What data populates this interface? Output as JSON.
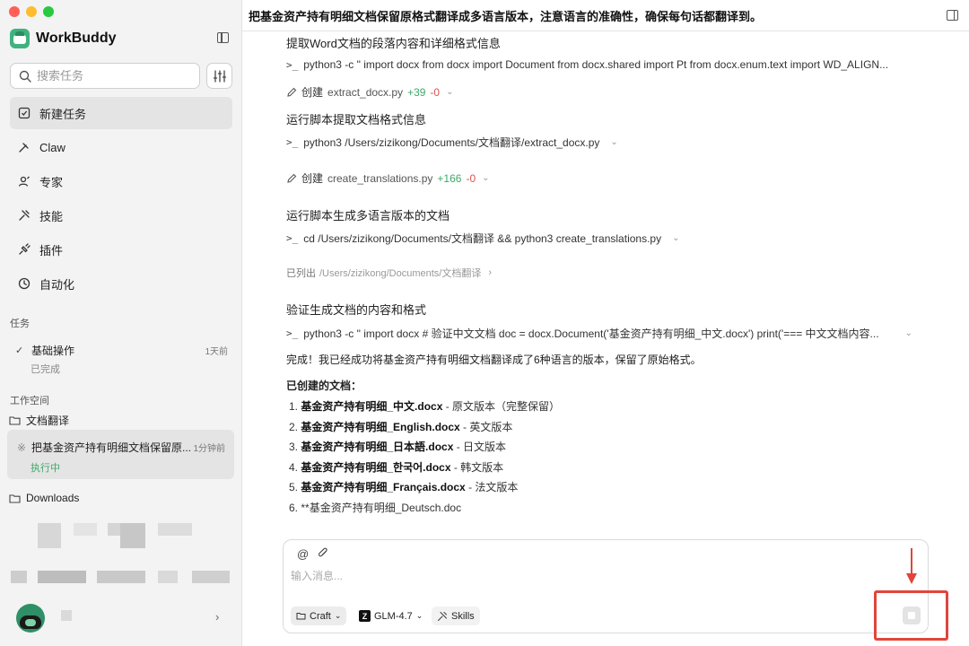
{
  "app": {
    "name": "WorkBuddy"
  },
  "sidebar": {
    "search_placeholder": "搜索任务",
    "nav": [
      {
        "label": "新建任务",
        "icon": "edit-square-icon",
        "active": true
      },
      {
        "label": "Claw",
        "icon": "claw-icon"
      },
      {
        "label": "专家",
        "icon": "experts-icon"
      },
      {
        "label": "技能",
        "icon": "skills-icon"
      },
      {
        "label": "插件",
        "icon": "plugin-icon"
      },
      {
        "label": "自动化",
        "icon": "clock-icon"
      }
    ],
    "tasks_label": "任务",
    "task": {
      "title": "基础操作",
      "time": "1天前",
      "status": "已完成"
    },
    "workspace_label": "工作空间",
    "workspace_folder": "文档翻译",
    "running_task": {
      "title": "把基金资产持有明细文档保留原...",
      "time": "1分钟前",
      "status": "执行中"
    },
    "downloads_folder": "Downloads"
  },
  "main": {
    "title": "把基金资产持有明细文档保留原格式翻译成多语言版本，注意语言的准确性，确保每句话都翻译到。",
    "steps": {
      "extract_title": "提取Word文档的段落内容和详细格式信息",
      "cmd1": "python3 -c \" import docx from docx import Document from docx.shared import Pt from docx.enum.text import WD_ALIGN...",
      "create_label": "创建",
      "file1": {
        "name": "extract_docx.py",
        "plus": "+39",
        "minus": "-0"
      },
      "run_extract_title": "运行脚本提取文档格式信息",
      "cmd2": "python3 /Users/zizikong/Documents/文档翻译/extract_docx.py",
      "file2": {
        "name": "create_translations.py",
        "plus": "+166",
        "minus": "-0"
      },
      "run_generate_title": "运行脚本生成多语言版本的文档",
      "cmd3": "cd /Users/zizikong/Documents/文档翻译 && python3 create_translations.py",
      "listed_label": "已列出",
      "listed_path": "/Users/zizikong/Documents/文档翻译",
      "verify_title": "验证生成文档的内容和格式",
      "cmd4": "python3 -c \" import docx # 验证中文文档 doc = docx.Document('基金资产持有明细_中文.docx') print('=== 中文文档内容..."
    },
    "summary": "完成！我已经成功将基金资产持有明细文档翻译成了6种语言的版本，保留了原始格式。",
    "docs_header": "已创建的文档：",
    "docs": [
      {
        "num": "1.",
        "name": "基金资产持有明细_中文.docx",
        "desc": " - 原文版本（完整保留）"
      },
      {
        "num": "2.",
        "name": "基金资产持有明细_English.docx",
        "desc": " - 英文版本"
      },
      {
        "num": "3.",
        "name": "基金资产持有明细_日本語.docx",
        "desc": " - 日文版本"
      },
      {
        "num": "4.",
        "name": "基金资产持有明细_한국어.docx",
        "desc": " - 韩文版本"
      },
      {
        "num": "5.",
        "name": "基金资产持有明细_Français.docx",
        "desc": " - 法文版本"
      },
      {
        "num": "6.",
        "name": "",
        "desc": "**基金资产持有明细_Deutsch.doc"
      }
    ]
  },
  "composer": {
    "placeholder": "输入消息...",
    "mode": "Craft",
    "model": "GLM-4.7",
    "skills": "Skills"
  },
  "colors": {
    "accent_green": "#3fa86a",
    "annotation_red": "#e0453c",
    "sidebar_bg": "#f3f3f3"
  }
}
